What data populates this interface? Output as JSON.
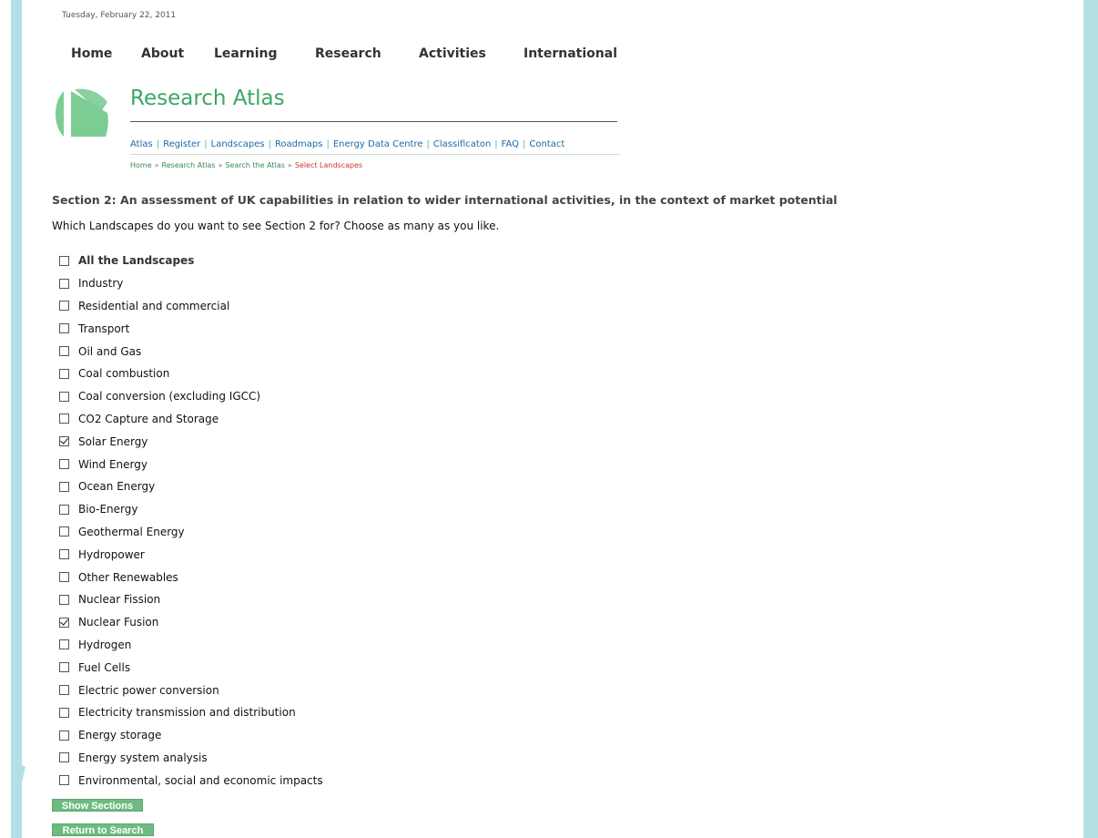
{
  "date": "Tuesday, February 22, 2011",
  "topnav": [
    "Home",
    "About",
    "Learning",
    "Research",
    "Activities",
    "International"
  ],
  "site_title": "Research Atlas",
  "subnav": [
    "Atlas",
    "Register",
    "Landscapes",
    "Roadmaps",
    "Energy Data Centre",
    "Classificaton",
    "FAQ",
    "Contact"
  ],
  "breadcrumb": {
    "items": [
      "Home",
      "Research Atlas",
      "Search the Atlas"
    ],
    "current": "Select Landscapes",
    "separator": "»"
  },
  "section_heading": "Section 2: An assessment of UK capabilities in relation to wider international activities, in the context of market potential",
  "question": "Which Landscapes do you want to see Section 2 for? Choose as many as you like.",
  "options": [
    {
      "label": "All the Landscapes",
      "checked": false,
      "bold": true
    },
    {
      "label": "Industry",
      "checked": false
    },
    {
      "label": "Residential and commercial",
      "checked": false
    },
    {
      "label": "Transport",
      "checked": false
    },
    {
      "label": "Oil and Gas",
      "checked": false
    },
    {
      "label": "Coal combustion",
      "checked": false
    },
    {
      "label": "Coal conversion (excluding IGCC)",
      "checked": false
    },
    {
      "label": "CO2 Capture and Storage",
      "checked": false
    },
    {
      "label": "Solar Energy",
      "checked": true
    },
    {
      "label": "Wind Energy",
      "checked": false
    },
    {
      "label": "Ocean Energy",
      "checked": false
    },
    {
      "label": "Bio-Energy",
      "checked": false
    },
    {
      "label": "Geothermal Energy",
      "checked": false
    },
    {
      "label": "Hydropower",
      "checked": false
    },
    {
      "label": "Other Renewables",
      "checked": false
    },
    {
      "label": "Nuclear Fission",
      "checked": false
    },
    {
      "label": "Nuclear Fusion",
      "checked": true
    },
    {
      "label": "Hydrogen",
      "checked": false
    },
    {
      "label": "Fuel Cells",
      "checked": false
    },
    {
      "label": "Electric power conversion",
      "checked": false
    },
    {
      "label": "Electricity transmission and distribution",
      "checked": false
    },
    {
      "label": "Energy storage",
      "checked": false
    },
    {
      "label": "Energy system analysis",
      "checked": false
    },
    {
      "label": "Environmental, social and economic impacts",
      "checked": false
    }
  ],
  "buttons": {
    "show_sections": "Show Sections",
    "return_to_search": "Return to Search"
  },
  "colors": {
    "accent_green": "#3aa766",
    "side_bar": "#b2e0e4",
    "button": "#6dbb82",
    "breadcrumb_current": "#d6332b",
    "link_blue": "#1a6ca8"
  }
}
